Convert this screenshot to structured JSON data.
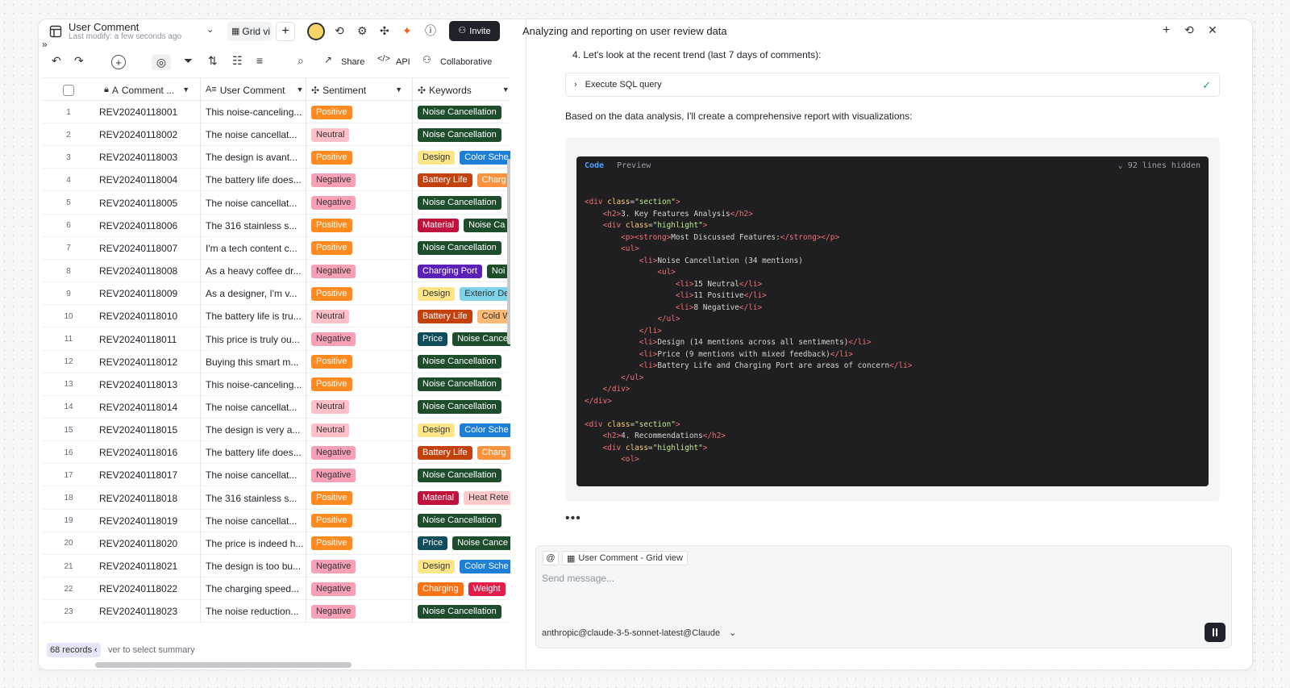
{
  "table": {
    "title": "User Comment",
    "subtitle": "Last modify: a few seconds ago",
    "view_tab": "Grid vi",
    "invite_label": "Invite",
    "toolbar": {
      "share": "Share",
      "api": "API",
      "collaborative": "Collaborative"
    },
    "columns": [
      "Comment ...",
      "User Comment",
      "Sentiment",
      "Keywords"
    ],
    "rows": [
      {
        "n": "1",
        "id": "REV20240118001",
        "comment": "This noise-canceling...",
        "sentiment": "Positive",
        "kw": [
          {
            "t": "Noise Cancellation",
            "c": "#1e4d2b"
          }
        ]
      },
      {
        "n": "2",
        "id": "REV20240118002",
        "comment": "The noise cancellat...",
        "sentiment": "Neutral",
        "kw": [
          {
            "t": "Noise Cancellation",
            "c": "#1e4d2b"
          }
        ]
      },
      {
        "n": "3",
        "id": "REV20240118003",
        "comment": "The design is avant...",
        "sentiment": "Positive",
        "kw": [
          {
            "t": "Design",
            "c": "#fde68a",
            "d": 1
          },
          {
            "t": "Color Sche",
            "c": "#1e7fd6"
          }
        ]
      },
      {
        "n": "4",
        "id": "REV20240118004",
        "comment": "The battery life does...",
        "sentiment": "Negative",
        "kw": [
          {
            "t": "Battery Life",
            "c": "#c2410c"
          },
          {
            "t": "Charg",
            "c": "#fb923c"
          }
        ]
      },
      {
        "n": "5",
        "id": "REV20240118005",
        "comment": "The noise cancellat...",
        "sentiment": "Negative",
        "kw": [
          {
            "t": "Noise Cancellation",
            "c": "#1e4d2b"
          }
        ]
      },
      {
        "n": "6",
        "id": "REV20240118006",
        "comment": "The 316 stainless s...",
        "sentiment": "Positive",
        "kw": [
          {
            "t": "Material",
            "c": "#be123c"
          },
          {
            "t": "Noise Ca",
            "c": "#1e4d2b"
          }
        ]
      },
      {
        "n": "7",
        "id": "REV20240118007",
        "comment": "I'm a tech content c...",
        "sentiment": "Positive",
        "kw": [
          {
            "t": "Noise Cancellation",
            "c": "#1e4d2b"
          }
        ]
      },
      {
        "n": "8",
        "id": "REV20240118008",
        "comment": "As a heavy coffee dr...",
        "sentiment": "Negative",
        "kw": [
          {
            "t": "Charging Port",
            "c": "#5b21b6"
          },
          {
            "t": "Noi",
            "c": "#1e4d2b"
          }
        ]
      },
      {
        "n": "9",
        "id": "REV20240118009",
        "comment": "As a designer, I'm v...",
        "sentiment": "Positive",
        "kw": [
          {
            "t": "Design",
            "c": "#fde68a",
            "d": 1
          },
          {
            "t": "Exterior De",
            "c": "#7dd3e8",
            "d": 1
          }
        ]
      },
      {
        "n": "10",
        "id": "REV20240118010",
        "comment": "The battery life is tru...",
        "sentiment": "Neutral",
        "kw": [
          {
            "t": "Battery Life",
            "c": "#c2410c"
          },
          {
            "t": "Cold W",
            "c": "#fdba74",
            "d": 1
          }
        ]
      },
      {
        "n": "11",
        "id": "REV20240118011",
        "comment": "This price is truly ou...",
        "sentiment": "Negative",
        "kw": [
          {
            "t": "Price",
            "c": "#0f4c5c"
          },
          {
            "t": "Noise Cance",
            "c": "#1e4d2b"
          }
        ]
      },
      {
        "n": "12",
        "id": "REV20240118012",
        "comment": "Buying this smart m...",
        "sentiment": "Positive",
        "kw": [
          {
            "t": "Noise Cancellation",
            "c": "#1e4d2b"
          }
        ]
      },
      {
        "n": "13",
        "id": "REV20240118013",
        "comment": "This noise-canceling...",
        "sentiment": "Positive",
        "kw": [
          {
            "t": "Noise Cancellation",
            "c": "#1e4d2b"
          }
        ]
      },
      {
        "n": "14",
        "id": "REV20240118014",
        "comment": "The noise cancellat...",
        "sentiment": "Neutral",
        "kw": [
          {
            "t": "Noise Cancellation",
            "c": "#1e4d2b"
          }
        ]
      },
      {
        "n": "15",
        "id": "REV20240118015",
        "comment": "The design is very a...",
        "sentiment": "Neutral",
        "kw": [
          {
            "t": "Design",
            "c": "#fde68a",
            "d": 1
          },
          {
            "t": "Color Sche",
            "c": "#1e7fd6"
          }
        ]
      },
      {
        "n": "16",
        "id": "REV20240118016",
        "comment": "The battery life does...",
        "sentiment": "Negative",
        "kw": [
          {
            "t": "Battery Life",
            "c": "#c2410c"
          },
          {
            "t": "Charg",
            "c": "#fb923c"
          }
        ]
      },
      {
        "n": "17",
        "id": "REV20240118017",
        "comment": "The noise cancellat...",
        "sentiment": "Negative",
        "kw": [
          {
            "t": "Noise Cancellation",
            "c": "#1e4d2b"
          }
        ]
      },
      {
        "n": "18",
        "id": "REV20240118018",
        "comment": "The 316 stainless s...",
        "sentiment": "Positive",
        "kw": [
          {
            "t": "Material",
            "c": "#be123c"
          },
          {
            "t": "Heat Rete",
            "c": "#fecaca",
            "d": 1
          }
        ]
      },
      {
        "n": "19",
        "id": "REV20240118019",
        "comment": "The noise cancellat...",
        "sentiment": "Positive",
        "kw": [
          {
            "t": "Noise Cancellation",
            "c": "#1e4d2b"
          }
        ]
      },
      {
        "n": "20",
        "id": "REV20240118020",
        "comment": "The price is indeed h...",
        "sentiment": "Positive",
        "kw": [
          {
            "t": "Price",
            "c": "#0f4c5c"
          },
          {
            "t": "Noise Cance",
            "c": "#1e4d2b"
          }
        ]
      },
      {
        "n": "21",
        "id": "REV20240118021",
        "comment": "The design is too bu...",
        "sentiment": "Negative",
        "kw": [
          {
            "t": "Design",
            "c": "#fde68a",
            "d": 1
          },
          {
            "t": "Color Sche",
            "c": "#1e7fd6"
          }
        ]
      },
      {
        "n": "22",
        "id": "REV20240118022",
        "comment": "The charging speed...",
        "sentiment": "Negative",
        "kw": [
          {
            "t": "Charging",
            "c": "#f97316"
          },
          {
            "t": "Weight",
            "c": "#e11d48"
          }
        ]
      },
      {
        "n": "23",
        "id": "REV20240118023",
        "comment": "The noise reduction...",
        "sentiment": "Negative",
        "kw": [
          {
            "t": "Noise Cancellation",
            "c": "#1e4d2b"
          }
        ]
      }
    ],
    "records": "68 records",
    "summary_hint": "ver to select summary"
  },
  "chat": {
    "title": "Analyzing and reporting on user review data",
    "step": "4. Let's look at the recent trend (last 7 days of comments):",
    "sql_label": "Execute SQL query",
    "based_text": "Based on the data analysis, I'll create a comprehensive report with visualizations:",
    "code_tab": "Code",
    "preview_tab": "Preview",
    "hidden": "92 lines hidden",
    "context_chip": "User Comment - Grid view",
    "placeholder": "Send message...",
    "model": "anthropic@claude-3-5-sonnet-latest@Claude",
    "dots": "•••"
  }
}
